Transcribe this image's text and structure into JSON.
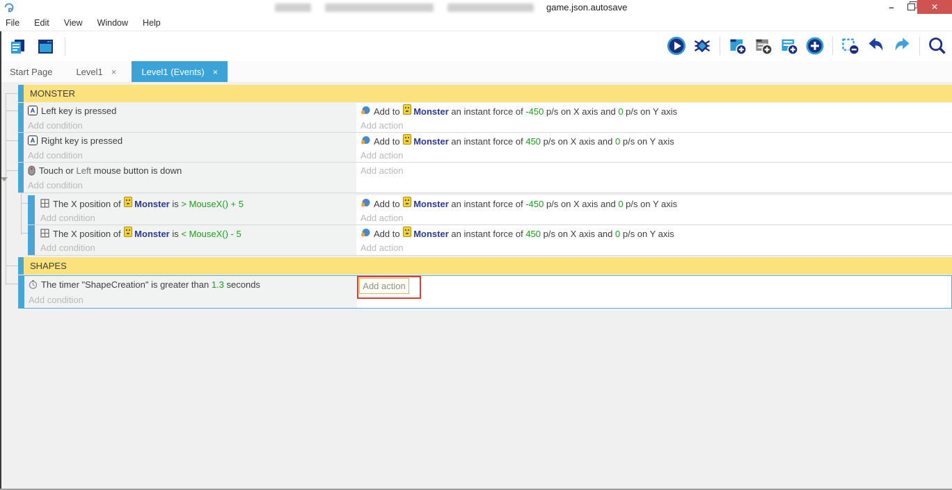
{
  "colors": {
    "accent_blue": "#3ba3d8",
    "event_bar_blue": "#49a5d8",
    "group_header_yellow": "#fbe27d",
    "condition_bg": "#f1f2f2",
    "param_green": "#1f9c20",
    "object_blue": "#2b3990",
    "placeholder_gray": "#b9b9b9",
    "close_button_red": "#cf5350",
    "annotation_red": "#e23a2e",
    "selected_border_blue": "#55aadc",
    "sprite_chip_yellow": "#f6d32b"
  },
  "titlebar": {
    "title_visible": "game.json.autosave",
    "minimize": "–",
    "close": "✕"
  },
  "menubar": {
    "items": [
      "File",
      "Edit",
      "View",
      "Window",
      "Help"
    ]
  },
  "toolbar": {
    "left_icons": [
      "project-manager-icon",
      "scene-editor-icon"
    ],
    "right_icons": [
      "play-icon",
      "debug-bug-icon",
      "add-event-icon",
      "add-comment-icon",
      "add-subevent-icon",
      "add-plus-icon",
      "remove-selection-icon",
      "undo-icon",
      "redo-icon",
      "search-icon"
    ]
  },
  "tabs": {
    "items": [
      {
        "label": "Start Page",
        "close": "",
        "active": false
      },
      {
        "label": "Level1",
        "close": "×",
        "active": false
      },
      {
        "label": "Level1 (Events)",
        "close": "×",
        "active": true
      }
    ]
  },
  "events": {
    "group_monster": "MONSTER",
    "group_shapes": "SHAPES",
    "placeholders": {
      "add_condition": "Add condition",
      "add_action": "Add action"
    },
    "force_action_neg": [
      {
        "t": "Add to ",
        "c": "text"
      },
      {
        "c": "sprite"
      },
      {
        "t": "Monster",
        "c": "object"
      },
      {
        "t": " an instant force of ",
        "c": "text"
      },
      {
        "t": "-450",
        "c": "param"
      },
      {
        "t": " p/s on X axis and ",
        "c": "text"
      },
      {
        "t": "0",
        "c": "param"
      },
      {
        "t": " p/s on Y axis",
        "c": "text"
      }
    ],
    "force_action_pos": [
      {
        "t": "Add to ",
        "c": "text"
      },
      {
        "c": "sprite"
      },
      {
        "t": "Monster",
        "c": "object"
      },
      {
        "t": " an instant force of ",
        "c": "text"
      },
      {
        "t": "450",
        "c": "param"
      },
      {
        "t": " p/s on X axis and ",
        "c": "text"
      },
      {
        "t": "0",
        "c": "param"
      },
      {
        "t": " p/s on Y axis",
        "c": "text"
      }
    ],
    "row_left_key": {
      "icon": "keyboard-key-icon",
      "key_glyph": "A",
      "condition": [
        {
          "t": "Left key is pressed",
          "c": "text"
        }
      ]
    },
    "row_right_key": {
      "icon": "keyboard-key-icon",
      "key_glyph": "A",
      "condition": [
        {
          "t": "Right key is pressed",
          "c": "text"
        }
      ]
    },
    "row_touch": {
      "icon": "mouse-icon",
      "condition": [
        {
          "t": "Touch or ",
          "c": "text"
        },
        {
          "t": "Left",
          "c": "muted"
        },
        {
          "t": " mouse button is down",
          "c": "text"
        }
      ]
    },
    "row_pos_gt": {
      "icon": "position-icon",
      "condition": [
        {
          "t": "The X position of ",
          "c": "text"
        },
        {
          "c": "sprite"
        },
        {
          "t": "Monster",
          "c": "object"
        },
        {
          "t": " is ",
          "c": "text"
        },
        {
          "t": "> MouseX() + 5",
          "c": "param"
        }
      ]
    },
    "row_pos_lt": {
      "icon": "position-icon",
      "condition": [
        {
          "t": "The X position of ",
          "c": "text"
        },
        {
          "c": "sprite"
        },
        {
          "t": "Monster",
          "c": "object"
        },
        {
          "t": " is ",
          "c": "text"
        },
        {
          "t": "< MouseX() - 5",
          "c": "param"
        }
      ]
    },
    "row_timer": {
      "icon": "timer-icon",
      "condition": [
        {
          "t": "The timer \"ShapeCreation\" is greater than ",
          "c": "text"
        },
        {
          "t": "1.3",
          "c": "param"
        },
        {
          "t": " seconds",
          "c": "text"
        }
      ]
    }
  }
}
